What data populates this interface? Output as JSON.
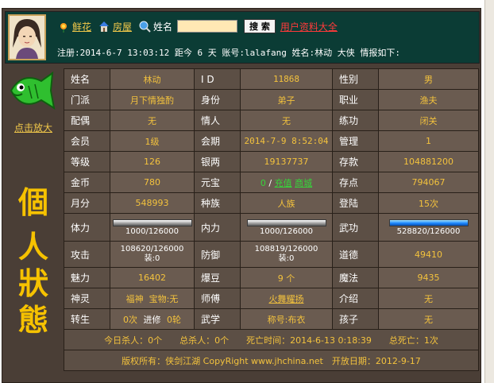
{
  "header": {
    "links": [
      "鲜花",
      "房屋"
    ],
    "name_label": "姓名",
    "name_input_value": "",
    "search_button": "搜 索",
    "user_data_link": "用户资料大全",
    "info_line": "注册:2014-6-7 13:03:12 距今 6 天 账号:lalafang 姓名:林动 大侠 情报如下:"
  },
  "sidebar": {
    "enlarge_link": "点击放大",
    "title_chars": [
      "個",
      "人",
      "狀",
      "態"
    ]
  },
  "table": {
    "rows": [
      [
        {
          "l": "姓名",
          "v": "林动"
        },
        {
          "l": "I D",
          "v": "11868"
        },
        {
          "l": "性别",
          "v": "男"
        }
      ],
      [
        {
          "l": "门派",
          "v": "月下情独酌"
        },
        {
          "l": "身份",
          "v": "弟子"
        },
        {
          "l": "职业",
          "v": "渔夫"
        }
      ],
      [
        {
          "l": "配偶",
          "v": "无"
        },
        {
          "l": "情人",
          "v": "无"
        },
        {
          "l": "练功",
          "v": "闭关"
        }
      ],
      [
        {
          "l": "会员",
          "v": "1级"
        },
        {
          "l": "会期",
          "v": "2014-7-9 8:52:04"
        },
        {
          "l": "管理",
          "v": "1"
        }
      ],
      [
        {
          "l": "等级",
          "v": "126"
        },
        {
          "l": "银两",
          "v": "19137737"
        },
        {
          "l": "存款",
          "v": "104881200"
        }
      ],
      [
        {
          "l": "金币",
          "v": "780"
        },
        {
          "l": "元宝",
          "v": "0"
        },
        {
          "l": "存点",
          "v": "794067"
        }
      ],
      [
        {
          "l": "月分",
          "v": "548993"
        },
        {
          "l": "种族",
          "v": "人族"
        },
        {
          "l": "登陆",
          "v": "15次"
        }
      ]
    ],
    "yuanbao_links": [
      "充值",
      "商城"
    ],
    "stats": {
      "tili_label": "体力",
      "tili_text": "1000/126000",
      "tili_fill": 0.99,
      "neili_label": "内力",
      "neili_text": "1000/126000",
      "neili_fill": 0.99,
      "wugong_label": "武功",
      "wugong_text": "528820/126000",
      "wugong_fill": 1.0
    },
    "attack": {
      "label": "攻击",
      "line1": "108620/126000",
      "line2": "装:0"
    },
    "defense": {
      "label": "防御",
      "line1": "108819/126000",
      "line2": "装:0"
    },
    "daode": {
      "label": "道德",
      "value": "49410"
    },
    "row_meili": [
      {
        "l": "魅力",
        "v": "16402"
      },
      {
        "l": "爆豆",
        "v": "9 个"
      },
      {
        "l": "魔法",
        "v": "9435"
      }
    ],
    "row_shenling": {
      "l1": "神灵",
      "v1a": "福神",
      "v1b": "宝物:无",
      "l2": "师傅",
      "v2": "火舞耀扬",
      "l3": "介绍",
      "v3": "无"
    },
    "row_zhuansheng": {
      "l1": "转生",
      "v1a": "0次",
      "l1b": "进修",
      "v1b": "0轮",
      "l2": "武学",
      "v2": "称号:布衣",
      "l3": "孩子",
      "v3": "无"
    },
    "footer1": "今日杀人：0个　　总杀人：0个　　死亡时间：2014-6-13 0:18:39　　总死亡：1次",
    "footer2": "版权所有：侠剑江湖 CopyRight www.jhchina.net　开放日期：2012-9-17"
  }
}
